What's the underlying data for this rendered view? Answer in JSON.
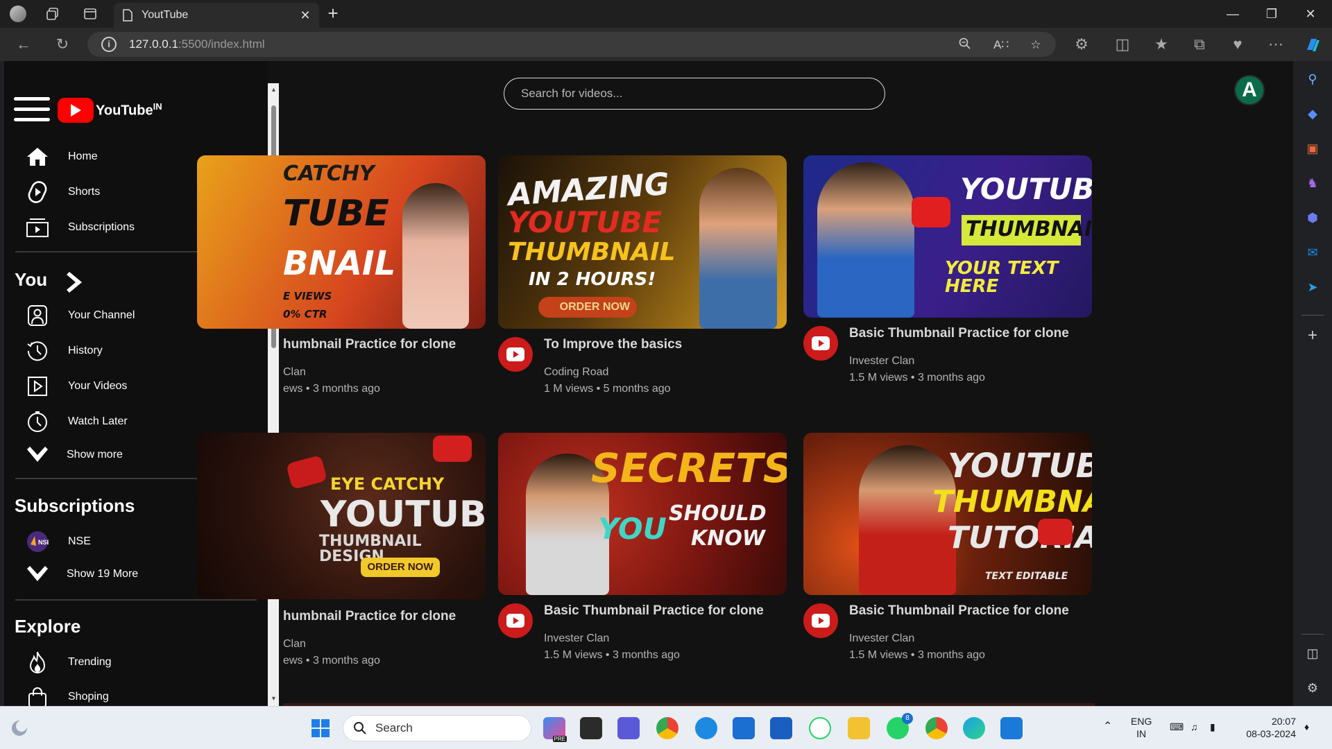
{
  "browser": {
    "tab_title": "YoutTube",
    "url_host": "127.0.0.1",
    "url_path": ":5500/index.html",
    "close_glyph": "✕",
    "newtab_glyph": "+"
  },
  "sidebar": {
    "logo_text": "YouTube",
    "logo_sup": "IN",
    "main_items": [
      {
        "label": "Home",
        "icon": "home-icon"
      },
      {
        "label": "Shorts",
        "icon": "shorts-icon"
      },
      {
        "label": "Subscriptions",
        "icon": "subscriptions-icon"
      }
    ],
    "you_heading": "You",
    "you_items": [
      {
        "label": "Your Channel",
        "icon": "channel-icon"
      },
      {
        "label": "History",
        "icon": "history-icon"
      },
      {
        "label": "Your Videos",
        "icon": "your-videos-icon"
      },
      {
        "label": "Watch Later",
        "icon": "clock-icon"
      },
      {
        "label": "Show more",
        "icon": "chevron-down-icon"
      }
    ],
    "subs_heading": "Subscriptions",
    "subs_items": [
      {
        "label": "NSE",
        "icon": "nse-avatar"
      },
      {
        "label": "Show 19 More",
        "icon": "chevron-down-icon"
      }
    ],
    "explore_heading": "Explore",
    "explore_items": [
      {
        "label": "Trending",
        "icon": "fire-icon"
      },
      {
        "label": "Shoping",
        "icon": "bag-icon"
      }
    ]
  },
  "search": {
    "placeholder": "Search for videos..."
  },
  "account": {
    "initial": "A"
  },
  "videos": [
    {
      "title": "humbnail Practice for clone",
      "channel": "Clan",
      "meta": "ews • 3 months ago",
      "thumb_lines": [
        "CATCHY",
        "TUBE",
        "BNAIL",
        "E VIEWS",
        "0% CTR"
      ]
    },
    {
      "title": "To Improve the basics",
      "channel": "Coding Road",
      "meta": "1 M views • 5 months ago",
      "thumb_lines": [
        "AMAZING",
        "YOUTUBE",
        "THUMBNAIL",
        "IN 2 HOURS!",
        "ORDER NOW"
      ]
    },
    {
      "title": "Basic Thumbnail Practice for clone",
      "channel": "Invester Clan",
      "meta": "1.5 M views • 3 months ago",
      "thumb_lines": [
        "YOUTUBE",
        "THUMBNAIL",
        "YOUR TEXT HERE"
      ]
    },
    {
      "title": "humbnail Practice for clone",
      "channel": "Clan",
      "meta": "ews • 3 months ago",
      "thumb_lines": [
        "EYE CATCHY",
        "YOUTUBE",
        "THUMBNAIL DESIGN",
        "ORDER NOW"
      ]
    },
    {
      "title": "Basic Thumbnail Practice for clone",
      "channel": "Invester Clan",
      "meta": "1.5 M views • 3 months ago",
      "thumb_lines": [
        "SECRETS",
        "YOU",
        "SHOULD",
        "KNOW"
      ]
    },
    {
      "title": "Basic Thumbnail Practice for clone",
      "channel": "Invester Clan",
      "meta": "1.5 M views • 3 months ago",
      "thumb_lines": [
        "YOUTUBE",
        "THUMBNAIL",
        "TUTORIAL",
        "TEXT EDITABLE"
      ]
    }
  ],
  "taskbar": {
    "search_label": "Search",
    "lang_line1": "ENG",
    "lang_line2": "IN",
    "time": "20:07",
    "date": "08-03-2024",
    "whatsapp_badge": "8",
    "copilot_badge": "PRE"
  },
  "colors": {
    "accent": "#ff0000",
    "avatar_bg": "#0a6b4b",
    "page_bg": "#121212",
    "sidebar_bg": "#0f0f0f"
  }
}
